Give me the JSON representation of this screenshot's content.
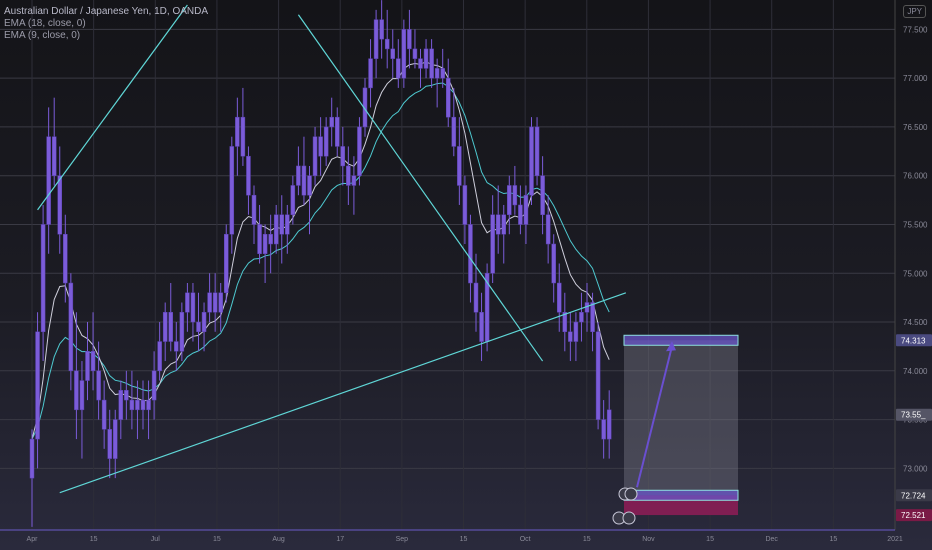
{
  "header": {
    "symbol": "Australian Dollar / Japanese Yen, 1D, OANDA",
    "indicators": [
      "EMA (18, close, 0)",
      "EMA (9, close, 0)"
    ],
    "currency": "JPY"
  },
  "axis": {
    "price_ticks": [
      "77.500",
      "77.000",
      "76.500",
      "76.000",
      "75.500",
      "75.000",
      "74.500",
      "74.000",
      "73.500",
      "73.000"
    ],
    "time_ticks": [
      "Apr",
      "15",
      "Jul",
      "15",
      "Aug",
      "17",
      "Sep",
      "15",
      "Oct",
      "15",
      "Nov",
      "15",
      "Dec",
      "15",
      "2021"
    ],
    "badges": [
      {
        "label": "74.313",
        "value": 74.313,
        "color": "#4a4a80"
      },
      {
        "label": "73.55_",
        "value": 73.55,
        "color": "#555566"
      },
      {
        "label": "72.724",
        "value": 72.724,
        "color": "#3a3a48"
      },
      {
        "label": "72.521",
        "value": 72.521,
        "color": "#7a1a46"
      }
    ]
  },
  "colors": {
    "candle": "#7b5cd9",
    "ema": "#4ec9d0",
    "trend": "#5fd6d6",
    "target": "#6a55c8",
    "stop": "#8a1d55"
  },
  "chart_data": {
    "type": "candlestick",
    "title": "Australian Dollar / Japanese Yen, 1D, OANDA",
    "ylim": [
      72.45,
      77.75
    ],
    "grid": true,
    "candles": [
      [
        72.9,
        73.4,
        72.4,
        73.3
      ],
      [
        73.3,
        74.6,
        73.0,
        74.4
      ],
      [
        74.4,
        75.7,
        74.1,
        75.5
      ],
      [
        75.5,
        76.7,
        75.2,
        76.4
      ],
      [
        76.4,
        76.8,
        75.9,
        76.0
      ],
      [
        76.0,
        76.3,
        75.2,
        75.4
      ],
      [
        75.4,
        75.6,
        74.7,
        74.9
      ],
      [
        74.9,
        75.0,
        73.8,
        74.0
      ],
      [
        74.0,
        74.6,
        73.3,
        73.6
      ],
      [
        73.6,
        74.1,
        73.1,
        73.9
      ],
      [
        73.9,
        74.5,
        73.7,
        74.2
      ],
      [
        74.2,
        74.6,
        73.8,
        74.0
      ],
      [
        74.0,
        74.3,
        73.5,
        73.7
      ],
      [
        73.7,
        73.9,
        73.2,
        73.4
      ],
      [
        73.4,
        73.6,
        72.9,
        73.1
      ],
      [
        73.1,
        73.6,
        72.9,
        73.5
      ],
      [
        73.5,
        73.9,
        73.3,
        73.8
      ],
      [
        73.8,
        74.0,
        73.5,
        73.7
      ],
      [
        73.7,
        74.0,
        73.4,
        73.6
      ],
      [
        73.6,
        73.9,
        73.3,
        73.7
      ],
      [
        73.7,
        73.9,
        73.4,
        73.6
      ],
      [
        73.6,
        73.9,
        73.3,
        73.7
      ],
      [
        73.7,
        74.2,
        73.5,
        74.0
      ],
      [
        74.0,
        74.5,
        73.9,
        74.3
      ],
      [
        74.3,
        74.7,
        74.1,
        74.6
      ],
      [
        74.6,
        74.9,
        74.2,
        74.3
      ],
      [
        74.3,
        74.5,
        74.0,
        74.2
      ],
      [
        74.2,
        74.7,
        74.1,
        74.6
      ],
      [
        74.6,
        74.9,
        74.4,
        74.8
      ],
      [
        74.8,
        74.9,
        74.3,
        74.5
      ],
      [
        74.5,
        74.8,
        74.2,
        74.4
      ],
      [
        74.4,
        74.7,
        74.2,
        74.6
      ],
      [
        74.6,
        75.0,
        74.5,
        74.8
      ],
      [
        74.8,
        75.0,
        74.4,
        74.6
      ],
      [
        74.6,
        74.9,
        74.4,
        74.8
      ],
      [
        74.8,
        75.5,
        74.7,
        75.4
      ],
      [
        75.4,
        76.4,
        75.2,
        76.3
      ],
      [
        76.3,
        76.8,
        76.0,
        76.6
      ],
      [
        76.6,
        76.9,
        76.1,
        76.2
      ],
      [
        76.2,
        76.3,
        75.6,
        75.8
      ],
      [
        75.8,
        75.9,
        75.3,
        75.5
      ],
      [
        75.5,
        75.7,
        75.1,
        75.2
      ],
      [
        75.2,
        75.5,
        74.9,
        75.4
      ],
      [
        75.4,
        75.6,
        75.0,
        75.3
      ],
      [
        75.3,
        75.7,
        75.2,
        75.6
      ],
      [
        75.6,
        75.8,
        75.1,
        75.4
      ],
      [
        75.4,
        75.7,
        75.2,
        75.6
      ],
      [
        75.6,
        76.0,
        75.5,
        75.9
      ],
      [
        75.9,
        76.3,
        75.8,
        76.1
      ],
      [
        76.1,
        76.4,
        75.7,
        75.8
      ],
      [
        75.8,
        76.1,
        75.4,
        76.0
      ],
      [
        76.0,
        76.5,
        75.9,
        76.4
      ],
      [
        76.4,
        76.6,
        76.0,
        76.2
      ],
      [
        76.2,
        76.6,
        76.1,
        76.5
      ],
      [
        76.5,
        76.8,
        76.3,
        76.6
      ],
      [
        76.6,
        76.7,
        76.2,
        76.3
      ],
      [
        76.3,
        76.5,
        75.9,
        76.1
      ],
      [
        76.1,
        76.3,
        75.7,
        75.9
      ],
      [
        75.9,
        76.2,
        75.6,
        76.0
      ],
      [
        76.0,
        76.6,
        75.9,
        76.5
      ],
      [
        76.5,
        77.0,
        76.4,
        76.9
      ],
      [
        76.9,
        77.4,
        76.7,
        77.2
      ],
      [
        77.2,
        77.7,
        77.0,
        77.6
      ],
      [
        77.6,
        77.8,
        77.2,
        77.4
      ],
      [
        77.4,
        77.7,
        77.1,
        77.3
      ],
      [
        77.3,
        77.5,
        77.0,
        77.2
      ],
      [
        77.2,
        77.4,
        76.9,
        77.0
      ],
      [
        77.0,
        77.6,
        76.9,
        77.5
      ],
      [
        77.5,
        77.7,
        77.1,
        77.3
      ],
      [
        77.3,
        77.5,
        77.1,
        77.2
      ],
      [
        77.2,
        77.3,
        76.9,
        77.1
      ],
      [
        77.1,
        77.4,
        77.0,
        77.3
      ],
      [
        77.3,
        77.4,
        76.9,
        77.0
      ],
      [
        77.0,
        77.2,
        76.7,
        77.1
      ],
      [
        77.1,
        77.3,
        76.9,
        77.0
      ],
      [
        77.0,
        77.2,
        76.5,
        76.6
      ],
      [
        76.6,
        76.9,
        76.2,
        76.3
      ],
      [
        76.3,
        76.6,
        75.7,
        75.9
      ],
      [
        75.9,
        76.0,
        75.3,
        75.5
      ],
      [
        75.5,
        75.6,
        74.7,
        74.9
      ],
      [
        74.9,
        75.2,
        74.4,
        74.6
      ],
      [
        74.6,
        74.8,
        74.1,
        74.3
      ],
      [
        74.3,
        75.1,
        74.2,
        75.0
      ],
      [
        75.0,
        75.8,
        74.9,
        75.6
      ],
      [
        75.6,
        75.9,
        75.2,
        75.4
      ],
      [
        75.4,
        75.7,
        75.1,
        75.6
      ],
      [
        75.6,
        76.0,
        75.4,
        75.9
      ],
      [
        75.9,
        76.1,
        75.6,
        75.7
      ],
      [
        75.7,
        75.9,
        75.4,
        75.5
      ],
      [
        75.5,
        75.9,
        75.3,
        75.8
      ],
      [
        75.8,
        76.6,
        75.7,
        76.5
      ],
      [
        76.5,
        76.6,
        75.9,
        76.0
      ],
      [
        76.0,
        76.2,
        75.4,
        75.6
      ],
      [
        75.6,
        75.8,
        75.1,
        75.3
      ],
      [
        75.3,
        75.4,
        74.7,
        74.9
      ],
      [
        74.9,
        75.1,
        74.4,
        74.6
      ],
      [
        74.6,
        74.8,
        74.2,
        74.4
      ],
      [
        74.4,
        74.6,
        74.1,
        74.3
      ],
      [
        74.3,
        74.6,
        74.1,
        74.5
      ],
      [
        74.5,
        74.8,
        74.3,
        74.6
      ],
      [
        74.6,
        74.9,
        74.4,
        74.7
      ],
      [
        74.7,
        74.8,
        74.2,
        74.4
      ],
      [
        74.4,
        74.5,
        73.4,
        73.5
      ],
      [
        73.5,
        73.7,
        73.1,
        73.3
      ],
      [
        73.3,
        73.8,
        73.1,
        73.6
      ]
    ],
    "ema_fast_label": "EMA (9, close, 0)",
    "ema_slow_label": "EMA (18, close, 0)",
    "trendlines": [
      {
        "from": [
          1,
          75.65
        ],
        "to": [
          28,
          77.75
        ]
      },
      {
        "from": [
          5,
          72.75
        ],
        "to": [
          107,
          74.8
        ]
      },
      {
        "from": [
          48,
          77.65
        ],
        "to": [
          92,
          74.1
        ]
      }
    ],
    "position": {
      "entry": 72.724,
      "target": 74.313,
      "stop": 72.521
    }
  }
}
